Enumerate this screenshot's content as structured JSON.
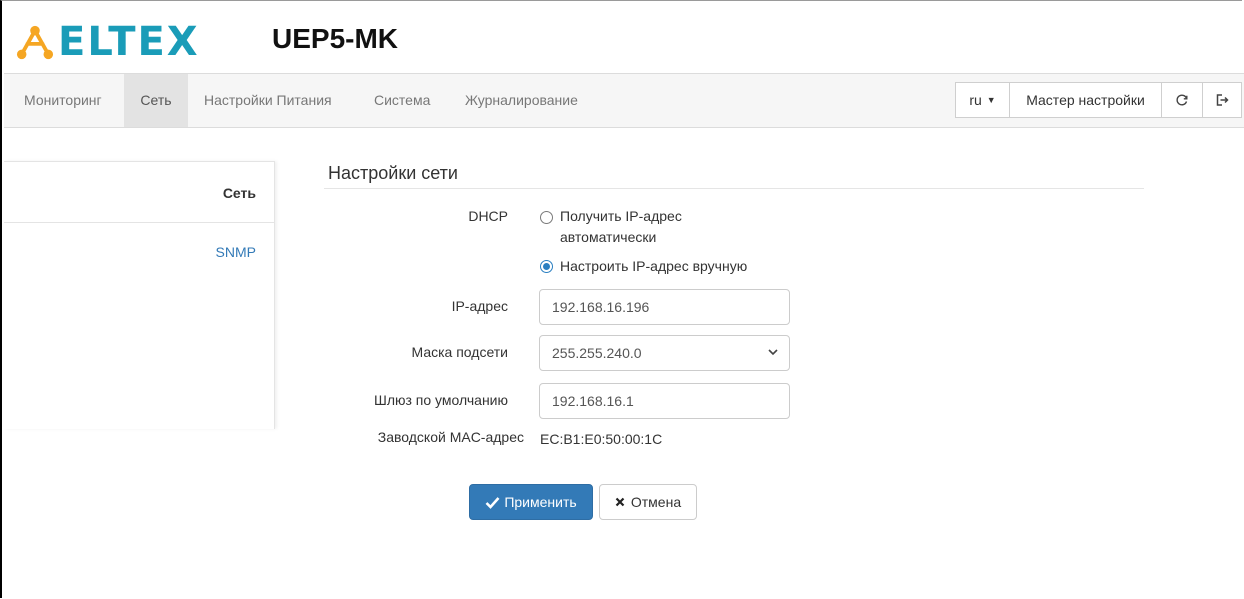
{
  "header": {
    "logo_text": "ELTEX",
    "product": "UEP5-MK"
  },
  "nav": {
    "items": [
      {
        "label": "Мониторинг"
      },
      {
        "label": "Сеть"
      },
      {
        "label": "Настройки Питания"
      },
      {
        "label": "Система"
      },
      {
        "label": "Журналирование"
      }
    ],
    "language": "ru",
    "wizard": "Мастер настройки",
    "icons": [
      "refresh-icon",
      "logout-icon"
    ]
  },
  "sidebar": {
    "items": [
      {
        "label": "Сеть"
      },
      {
        "label": "SNMP"
      }
    ]
  },
  "form": {
    "title": "Настройки сети",
    "dhcp_label": "DHCP",
    "dhcp_options": [
      {
        "label_line1": "Получить IP-адрес",
        "label_line2": "автоматически",
        "selected": false
      },
      {
        "label": "Настроить IP-адрес вручную",
        "selected": true
      }
    ],
    "ip_label": "IP-адрес",
    "ip_value": "192.168.16.196",
    "mask_label": "Маска подсети",
    "mask_value": "255.255.240.0",
    "gateway_label": "Шлюз по умолчанию",
    "gateway_value": "192.168.16.1",
    "mac_label": "Заводской MAC-адрес",
    "mac_value": "EC:B1:E0:50:00:1C"
  },
  "actions": {
    "apply": "Применить",
    "cancel": "Отмена"
  },
  "colors": {
    "brand": "#1a9cb8",
    "primary": "#337ab7",
    "link": "#337ab7",
    "navbar_bg": "#f6f6f6"
  }
}
